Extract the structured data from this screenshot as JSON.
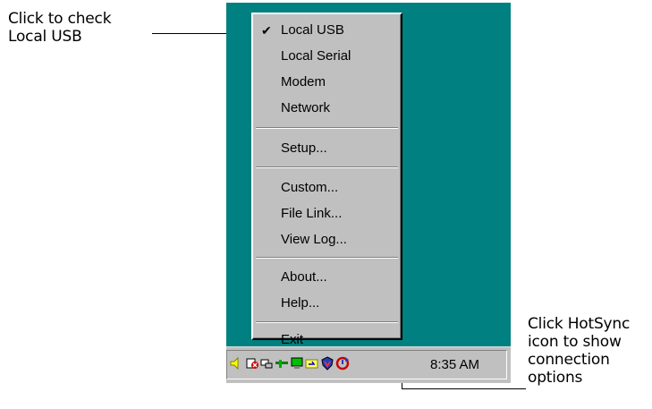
{
  "callouts": {
    "left_line1": "Click to check",
    "left_line2": "Local USB",
    "right_line1": "Click HotSync",
    "right_line2": "icon to show",
    "right_line3": "connection",
    "right_line4": "options"
  },
  "menu": {
    "items": [
      {
        "label": "Local USB",
        "checked": true
      },
      {
        "label": "Local Serial",
        "checked": false
      },
      {
        "label": "Modem",
        "checked": false
      },
      {
        "label": "Network",
        "checked": false
      },
      {
        "label": "Setup...",
        "checked": false
      },
      {
        "label": "Custom...",
        "checked": false
      },
      {
        "label": "File Link...",
        "checked": false
      },
      {
        "label": "View Log...",
        "checked": false
      },
      {
        "label": "About...",
        "checked": false
      },
      {
        "label": "Help...",
        "checked": false
      },
      {
        "label": "Exit",
        "checked": false
      }
    ],
    "check_glyph": "✔"
  },
  "taskbar": {
    "clock": "8:35 AM",
    "tray_icons": [
      "speaker-icon",
      "sound-mute-icon",
      "network-icon",
      "monitor-icon",
      "folder-sync-icon",
      "shield-icon",
      "hotsync-icon"
    ]
  },
  "colors": {
    "desktop": "#008080",
    "menu_face": "#c0c0c0"
  }
}
